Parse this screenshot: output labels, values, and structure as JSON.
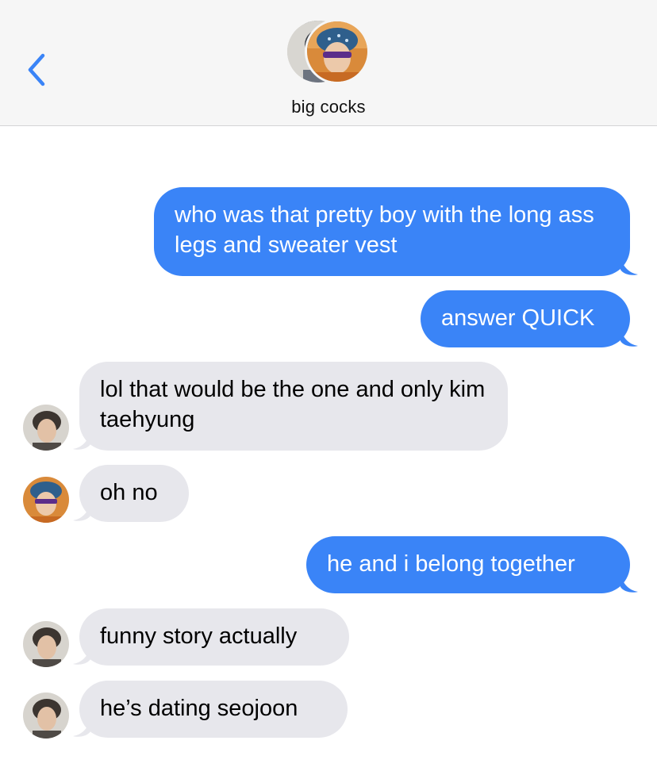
{
  "header": {
    "back_icon": "chevron-left-icon",
    "title": "big cocks",
    "avatar_icon": "group-avatar"
  },
  "colors": {
    "accent": "#3a84f7",
    "received_bubble": "#e7e7ec",
    "header_bg": "#f6f6f6"
  },
  "messages": [
    {
      "direction": "sent",
      "text": "who was that pretty boy with the long ass legs and sweater vest"
    },
    {
      "direction": "sent",
      "text": "answer QUICK"
    },
    {
      "direction": "received",
      "sender_avatar": "avatar-taehyung",
      "text": "lol that would be the one and only kim taehyung"
    },
    {
      "direction": "received",
      "sender_avatar": "avatar-bandana",
      "text": "oh no"
    },
    {
      "direction": "sent",
      "text": "he and i belong together"
    },
    {
      "direction": "received",
      "sender_avatar": "avatar-taehyung",
      "text": "funny story actually"
    },
    {
      "direction": "received",
      "sender_avatar": "avatar-taehyung",
      "text": "he’s dating seojoon"
    }
  ]
}
